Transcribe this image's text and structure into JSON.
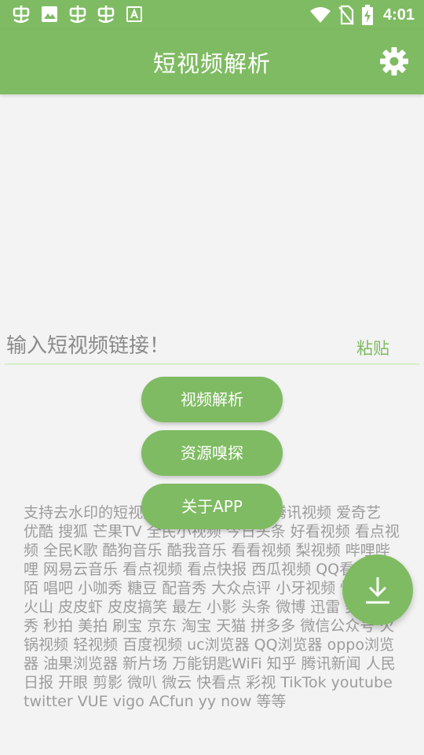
{
  "status_bar": {
    "time": "4:01",
    "left_icons": [
      "notification-app-icon",
      "image-icon",
      "notification-app-icon",
      "notification-app-icon",
      "keyboard-a-icon"
    ],
    "right_icons": [
      "wifi-icon",
      "no-sim-icon",
      "battery-charging-icon"
    ]
  },
  "app_bar": {
    "title": "短视频解析",
    "settings_icon": "gear-icon"
  },
  "input": {
    "placeholder": "输入短视频链接！",
    "value": "",
    "paste_label": "粘贴"
  },
  "buttons": {
    "parse_label": "视频解析",
    "sniff_label": "资源嗅探",
    "about_label": "关于APP"
  },
  "support_text": "支持去水印的短视频平台：抖音 快手 腾讯视频 爱奇艺 优酷 搜狐 芒果TV 全民小视频 今日头条 好看视频 看点视频 全民K歌 酷狗音乐 酷我音乐 看看视频 梨视频 哔哩哔哩 网易云音乐 看点视频 看点快报 西瓜视频 QQ看点 陌陌 唱吧 小咖秀 糖豆 配音秀 大众点评 小牙视频 懂车帝 火山 皮皮虾 皮皮搞笑 最左 小影 头条 微博 迅雷 美图秀秀 秒拍 美拍 刷宝 京东 淘宝 天猫 拼多多 微信公众号 火锅视频 轻视频 百度视频 uc浏览器 QQ浏览器 oppo浏览器 油果浏览器 新片场 万能钥匙WiFi 知乎 腾讯新闻 人民日报 开眼 剪影 微叭 微云 快看点 彩视 TikTok youtube twitter VUE vigo ACfun yy now 等等",
  "fab": {
    "icon": "download-icon"
  },
  "colors": {
    "primary": "#7fbb62",
    "background": "#f3f3f3",
    "support_text": "#9c9c9c",
    "input_underline": "#d4eec4"
  }
}
